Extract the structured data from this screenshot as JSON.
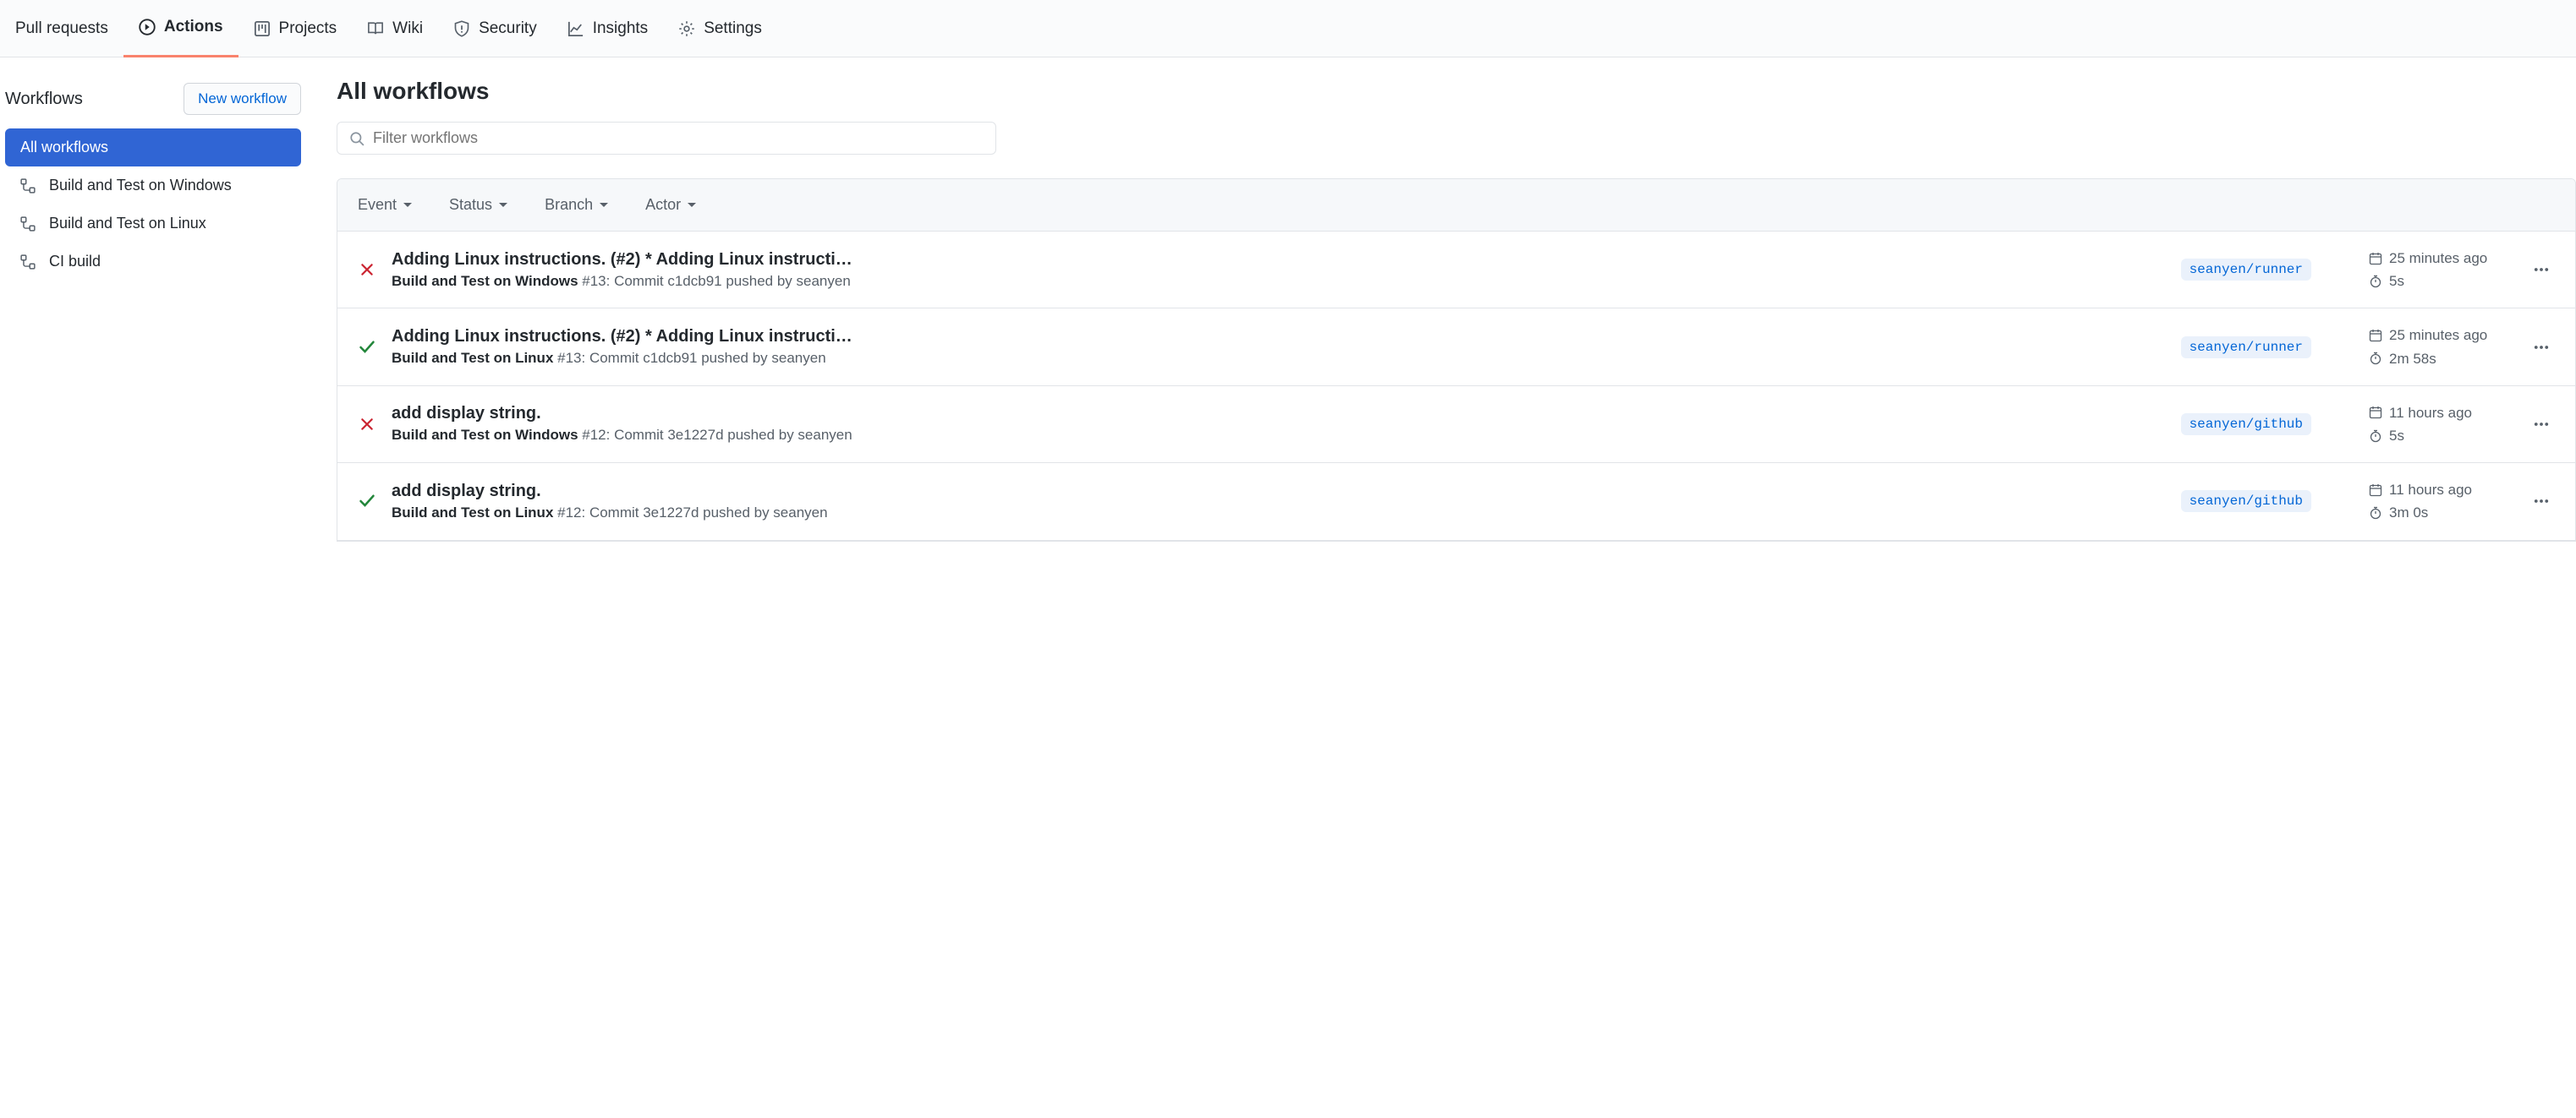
{
  "topnav": {
    "items": [
      {
        "label": "Pull requests"
      },
      {
        "label": "Actions"
      },
      {
        "label": "Projects"
      },
      {
        "label": "Wiki"
      },
      {
        "label": "Security"
      },
      {
        "label": "Insights"
      },
      {
        "label": "Settings"
      }
    ]
  },
  "sidebar": {
    "title": "Workflows",
    "new_btn": "New workflow",
    "items": [
      {
        "label": "All workflows"
      },
      {
        "label": "Build and Test on Windows"
      },
      {
        "label": "Build and Test on Linux"
      },
      {
        "label": "CI build"
      }
    ]
  },
  "main": {
    "title": "All workflows",
    "filter_placeholder": "Filter workflows",
    "dropdowns": {
      "event": "Event",
      "status": "Status",
      "branch": "Branch",
      "actor": "Actor"
    }
  },
  "runs": [
    {
      "status": "fail",
      "title": "Adding Linux instructions. (#2) * Adding Linux instructi…",
      "workflow": "Build and Test on Windows",
      "run_no": "#13",
      "detail": ": Commit c1dcb91 pushed by seanyen",
      "branch": "seanyen/runner",
      "time": "25 minutes ago",
      "duration": "5s"
    },
    {
      "status": "success",
      "title": "Adding Linux instructions. (#2) * Adding Linux instructi…",
      "workflow": "Build and Test on Linux",
      "run_no": "#13",
      "detail": ": Commit c1dcb91 pushed by seanyen",
      "branch": "seanyen/runner",
      "time": "25 minutes ago",
      "duration": "2m 58s"
    },
    {
      "status": "fail",
      "title": "add display string.",
      "workflow": "Build and Test on Windows",
      "run_no": "#12",
      "detail": ": Commit 3e1227d pushed by seanyen",
      "branch": "seanyen/github",
      "time": "11 hours ago",
      "duration": "5s"
    },
    {
      "status": "success",
      "title": "add display string.",
      "workflow": "Build and Test on Linux",
      "run_no": "#12",
      "detail": ": Commit 3e1227d pushed by seanyen",
      "branch": "seanyen/github",
      "time": "11 hours ago",
      "duration": "3m 0s"
    }
  ]
}
